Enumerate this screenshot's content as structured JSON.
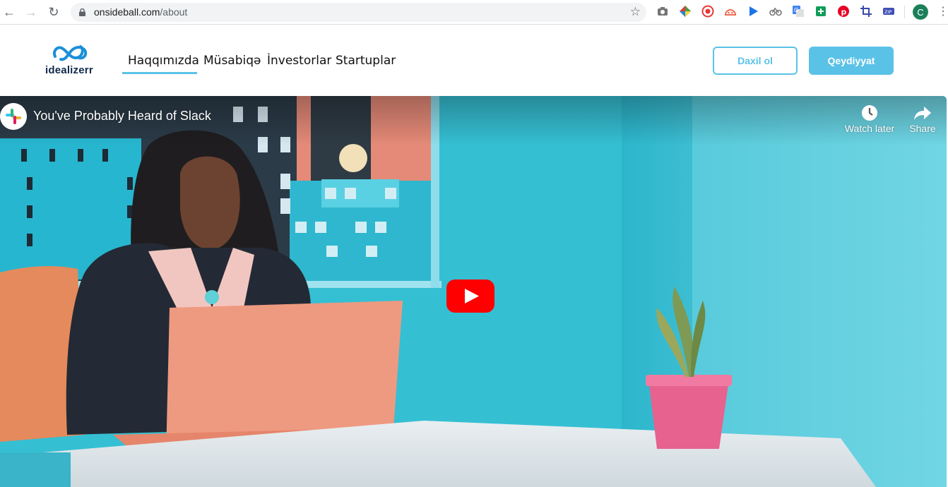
{
  "browser": {
    "url_domain": "onsideball.com",
    "url_path": "/about",
    "profile_initial": "C",
    "extension_icons": [
      "camera-icon",
      "color-wheel-icon",
      "record-icon",
      "fox-icon",
      "play-triangle-icon",
      "bike-icon",
      "translate-icon",
      "plus-square-icon",
      "pinterest-icon",
      "crop-icon",
      "zip-icon"
    ]
  },
  "site": {
    "logo_text": "idealizerr",
    "nav": {
      "items": [
        "Haqqımızda",
        "Müsabiqə",
        "İnvestorlar",
        "Startuplar"
      ],
      "active_index": 0
    },
    "login_label": "Daxil ol",
    "register_label": "Qeydiyyat",
    "accent_color": "#5bc2e7"
  },
  "video": {
    "title": "You've Probably Heard of Slack",
    "watch_later_label": "Watch later",
    "share_label": "Share",
    "play_icon": "youtube-play-icon"
  }
}
